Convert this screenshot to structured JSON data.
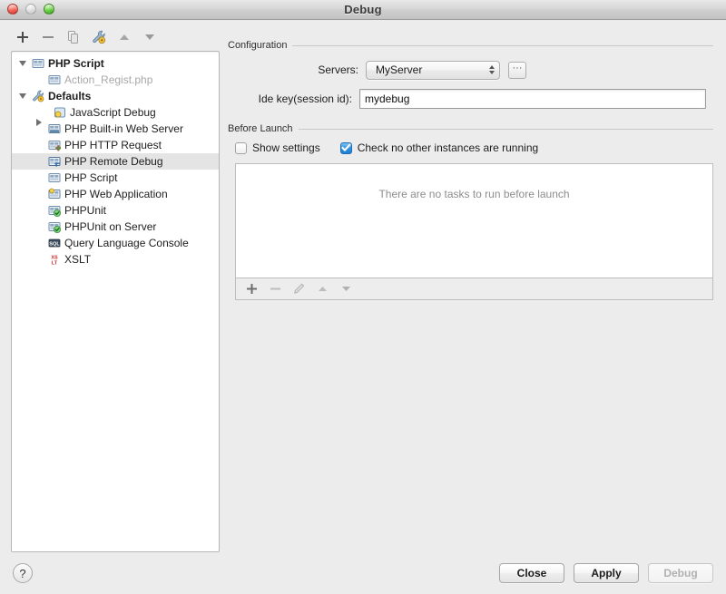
{
  "window": {
    "title": "Debug",
    "traffic_lights": [
      "close",
      "minimize",
      "zoom"
    ]
  },
  "tree_toolbar": {
    "buttons": [
      {
        "name": "add-configuration-button",
        "icon": "plus-icon",
        "label": "+"
      },
      {
        "name": "remove-configuration-button",
        "icon": "minus-icon",
        "label": "−"
      },
      {
        "name": "copy-configuration-button",
        "icon": "copy-icon",
        "label": "Copy"
      },
      {
        "name": "edit-defaults-button",
        "icon": "wrench-icon",
        "label": "Edit defaults"
      },
      {
        "name": "move-up-button",
        "icon": "arrow-up-icon",
        "label": "Move Up"
      },
      {
        "name": "move-down-button",
        "icon": "arrow-down-icon",
        "label": "Move Down"
      }
    ]
  },
  "tree": {
    "items": [
      {
        "label": "PHP Script",
        "icon": "php-script-icon",
        "level": 1,
        "twisty": "down",
        "bold": true,
        "muted": false,
        "selected": false
      },
      {
        "label": "Action_Regist.php",
        "icon": "php-script-icon",
        "level": 2,
        "twisty": "none",
        "bold": false,
        "muted": true,
        "selected": false
      },
      {
        "label": "Defaults",
        "icon": "wrench-icon",
        "level": 1,
        "twisty": "down",
        "bold": true,
        "muted": false,
        "selected": false
      },
      {
        "label": "JavaScript Debug",
        "icon": "javascript-debug-icon",
        "level": 2,
        "twisty": "right",
        "bold": false,
        "muted": false,
        "selected": false
      },
      {
        "label": "PHP Built-in Web Server",
        "icon": "php-web-server-icon",
        "level": 2,
        "twisty": "none",
        "bold": false,
        "muted": false,
        "selected": false
      },
      {
        "label": "PHP HTTP Request",
        "icon": "php-http-request-icon",
        "level": 2,
        "twisty": "none",
        "bold": false,
        "muted": false,
        "selected": false
      },
      {
        "label": "PHP Remote Debug",
        "icon": "php-remote-debug-icon",
        "level": 2,
        "twisty": "none",
        "bold": false,
        "muted": false,
        "selected": true
      },
      {
        "label": "PHP Script",
        "icon": "php-script-icon",
        "level": 2,
        "twisty": "none",
        "bold": false,
        "muted": false,
        "selected": false
      },
      {
        "label": "PHP Web Application",
        "icon": "php-web-app-icon",
        "level": 2,
        "twisty": "none",
        "bold": false,
        "muted": false,
        "selected": false
      },
      {
        "label": "PHPUnit",
        "icon": "phpunit-icon",
        "level": 2,
        "twisty": "none",
        "bold": false,
        "muted": false,
        "selected": false
      },
      {
        "label": "PHPUnit on Server",
        "icon": "phpunit-server-icon",
        "level": 2,
        "twisty": "none",
        "bold": false,
        "muted": false,
        "selected": false
      },
      {
        "label": "Query Language Console",
        "icon": "sql-console-icon",
        "level": 2,
        "twisty": "none",
        "bold": false,
        "muted": false,
        "selected": false
      },
      {
        "label": "XSLT",
        "icon": "xslt-icon",
        "level": 2,
        "twisty": "none",
        "bold": false,
        "muted": false,
        "selected": false
      }
    ]
  },
  "configuration": {
    "group_title": "Configuration",
    "servers_label": "Servers:",
    "servers_value": "MyServer",
    "servers_browse_label": "···",
    "idekey_label": "Ide key(session id):",
    "idekey_value": "mydebug",
    "idekey_placeholder": ""
  },
  "before_launch": {
    "group_title": "Before Launch",
    "show_settings_label": "Show settings",
    "show_settings_checked": false,
    "check_instances_label": "Check no other instances are running",
    "check_instances_checked": true,
    "empty_message": "There are no tasks to run before launch",
    "toolbar_buttons": [
      {
        "name": "add-task-button",
        "icon": "plus-icon"
      },
      {
        "name": "remove-task-button",
        "icon": "minus-icon"
      },
      {
        "name": "edit-task-button",
        "icon": "pencil-icon"
      },
      {
        "name": "move-task-up-button",
        "icon": "arrow-up-icon"
      },
      {
        "name": "move-task-down-button",
        "icon": "arrow-down-icon"
      }
    ]
  },
  "footer": {
    "help_label": "?",
    "close_label": "Close",
    "apply_label": "Apply",
    "debug_label": "Debug",
    "debug_disabled": true
  },
  "colors": {
    "window_bg": "#ececec",
    "selection": "#e4e4e4",
    "checkbox_on": "#2e90e0",
    "panel_border": "#bdbdbd",
    "muted_text": "#a8a8a8"
  }
}
